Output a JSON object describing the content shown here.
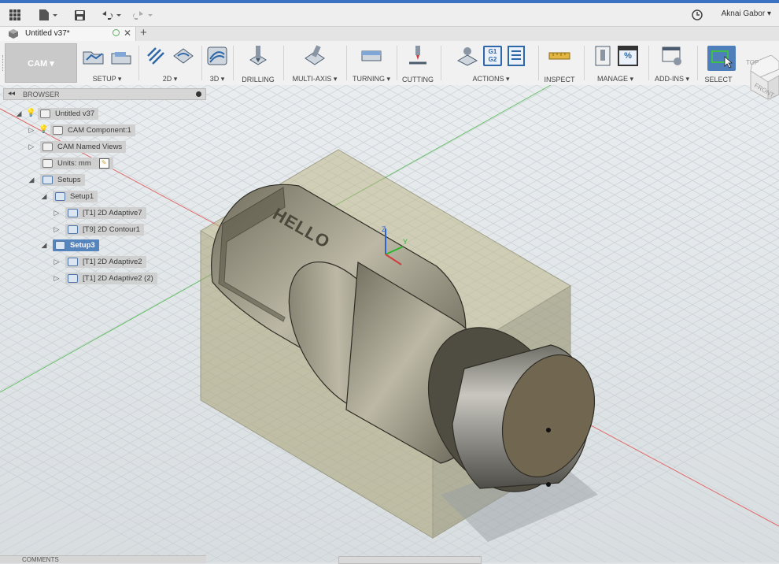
{
  "app": {
    "user_name": "Aknai Gabor"
  },
  "document_tab": {
    "title": "Untitled v37*"
  },
  "ribbon": {
    "workspace_label": "CAM ▾",
    "groups": [
      {
        "id": "setup",
        "label": "SETUP ▾"
      },
      {
        "id": "2d",
        "label": "2D ▾"
      },
      {
        "id": "3d",
        "label": "3D ▾"
      },
      {
        "id": "drilling",
        "label": "DRILLING"
      },
      {
        "id": "multi-axis",
        "label": "MULTI-AXIS ▾"
      },
      {
        "id": "turning",
        "label": "TURNING ▾"
      },
      {
        "id": "cutting",
        "label": "CUTTING"
      },
      {
        "id": "actions",
        "label": "ACTIONS ▾"
      },
      {
        "id": "inspect",
        "label": "INSPECT"
      },
      {
        "id": "manage",
        "label": "MANAGE ▾"
      },
      {
        "id": "add-ins",
        "label": "ADD-INS ▾"
      },
      {
        "id": "select",
        "label": "SELECT"
      }
    ],
    "actions_g_code": "G1 G2"
  },
  "browser": {
    "title": "BROWSER",
    "items": [
      {
        "label": "Untitled v37"
      },
      {
        "label": "CAM Component:1"
      },
      {
        "label": "CAM Named Views"
      },
      {
        "label": "Units: mm"
      },
      {
        "label": "Setups"
      },
      {
        "label": "Setup1"
      },
      {
        "label": "[T1] 2D Adaptive7"
      },
      {
        "label": "[T9] 2D Contour1"
      },
      {
        "label": "Setup3"
      },
      {
        "label": "[T1] 2D Adaptive2"
      },
      {
        "label": "[T1] 2D Adaptive2 (2)"
      }
    ]
  },
  "viewport": {
    "engraved_text": "HELLO",
    "view_cube_faces": {
      "top": "TOP",
      "front": "FRONT"
    },
    "axis_labels": {
      "z": "Z",
      "y": "Y"
    }
  },
  "comments_label": "COMMENTS",
  "colors": {
    "accent": "#3b73c2",
    "selection": "#4f7fba",
    "stock_box": "#a39a62",
    "part": "#7d7a68"
  }
}
